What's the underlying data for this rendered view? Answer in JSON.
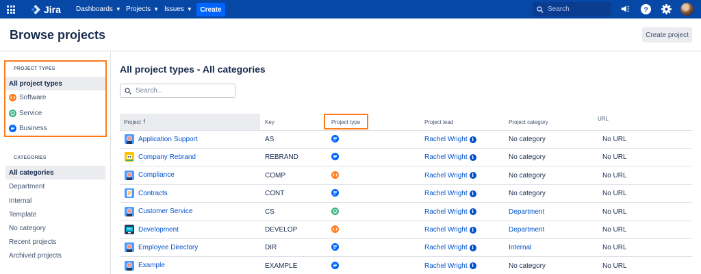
{
  "nav": {
    "logo_text": "Jira",
    "menus": [
      {
        "label": "Dashboards"
      },
      {
        "label": "Projects"
      },
      {
        "label": "Issues"
      }
    ],
    "create_label": "Create",
    "search_placeholder": "Search",
    "icons": [
      "app-switcher-icon",
      "jira-logo-icon",
      "megaphone-icon",
      "help-icon",
      "settings-icon",
      "avatar"
    ]
  },
  "header": {
    "title": "Browse projects",
    "create_project_label": "Create project"
  },
  "sidebar": {
    "types_heading": "PROJECT TYPES",
    "types": [
      {
        "label": "All project types",
        "icon": ""
      },
      {
        "label": "Software",
        "icon": "software-type-icon"
      },
      {
        "label": "Service",
        "icon": "service-type-icon"
      },
      {
        "label": "Business",
        "icon": "business-type-icon"
      }
    ],
    "categories_heading": "CATEGORIES",
    "categories": [
      {
        "label": "All categories"
      },
      {
        "label": "Department"
      },
      {
        "label": "Internal"
      },
      {
        "label": "Template"
      },
      {
        "label": "No category"
      },
      {
        "label": "Recent projects"
      },
      {
        "label": "Archived projects"
      }
    ]
  },
  "main": {
    "title": "All project types - All categories",
    "search_placeholder": "Search...",
    "columns": {
      "project": "Project",
      "key": "Key",
      "type": "Project type",
      "lead": "Project lead",
      "category": "Project category",
      "url": "URL"
    },
    "rows": [
      {
        "name": "Application Support",
        "key": "AS",
        "type": "business",
        "lead": "Rachel Wright",
        "category": "No category",
        "category_link": false,
        "url": "No URL",
        "avatar": "user"
      },
      {
        "name": "Company Rebrand",
        "key": "REBRAND",
        "type": "business",
        "lead": "Rachel Wright",
        "category": "No category",
        "category_link": false,
        "url": "No URL",
        "avatar": "robot"
      },
      {
        "name": "Compliance",
        "key": "COMP",
        "type": "software",
        "lead": "Rachel Wright",
        "category": "No category",
        "category_link": false,
        "url": "No URL",
        "avatar": "user"
      },
      {
        "name": "Contracts",
        "key": "CONT",
        "type": "business",
        "lead": "Rachel Wright",
        "category": "No category",
        "category_link": false,
        "url": "No URL",
        "avatar": "notepad"
      },
      {
        "name": "Customer Service",
        "key": "CS",
        "type": "service",
        "lead": "Rachel Wright",
        "category": "Department",
        "category_link": true,
        "url": "No URL",
        "avatar": "user"
      },
      {
        "name": "Development",
        "key": "DEVELOP",
        "type": "software",
        "lead": "Rachel Wright",
        "category": "Department",
        "category_link": true,
        "url": "No URL",
        "avatar": "monitor"
      },
      {
        "name": "Employee Directory",
        "key": "DIR",
        "type": "business",
        "lead": "Rachel Wright",
        "category": "Internal",
        "category_link": true,
        "url": "No URL",
        "avatar": "user"
      },
      {
        "name": "Example",
        "key": "EXAMPLE",
        "type": "business",
        "lead": "Rachel Wright",
        "category": "No category",
        "category_link": false,
        "url": "No URL",
        "avatar": "user"
      }
    ]
  },
  "colors": {
    "nav_bg": "#0747a6",
    "create_btn": "#0065ff",
    "link": "#0052cc",
    "highlight": "#ff7a1a",
    "software": "#ff7a1a",
    "service": "#36b37e",
    "business": "#0065ff"
  }
}
